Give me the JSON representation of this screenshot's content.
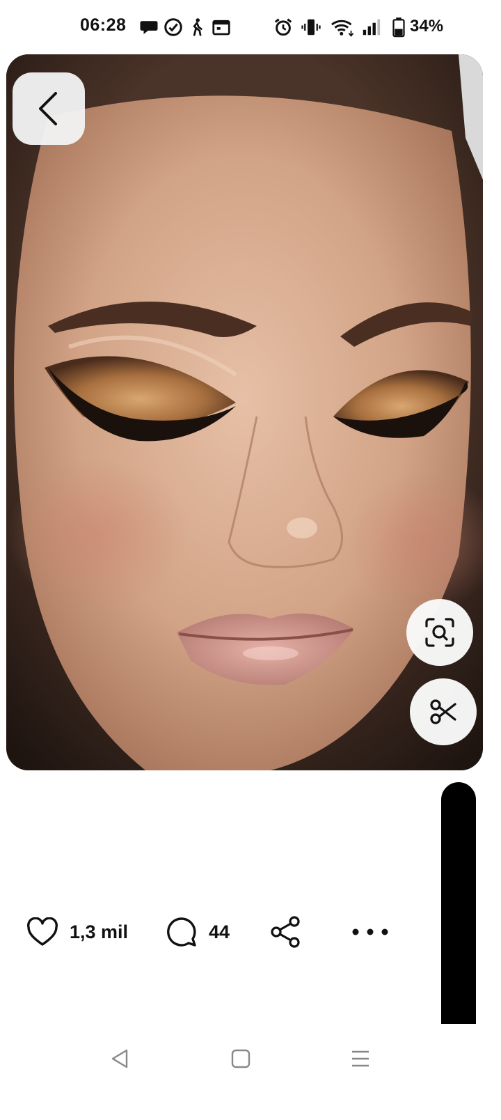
{
  "status_bar": {
    "time": "06:28",
    "battery": "34%",
    "left_icons": [
      "chat-bubble-icon",
      "check-circle-icon",
      "walking-icon",
      "calendar-icon"
    ],
    "right_icons": [
      "alarm-icon",
      "vibrate-icon",
      "wifi-icon",
      "signal-icon",
      "battery-icon"
    ]
  },
  "pin": {
    "image_description_icon": "makeup-face-image",
    "back_icon": "chevron-left-icon",
    "lens_icon": "visual-search-icon",
    "scissors_icon": "scissors-icon"
  },
  "actions": {
    "likes": "1,3 mil",
    "comments": "44"
  },
  "colors": {
    "accent": "#000000",
    "button_bg": "#f2f2f2"
  }
}
